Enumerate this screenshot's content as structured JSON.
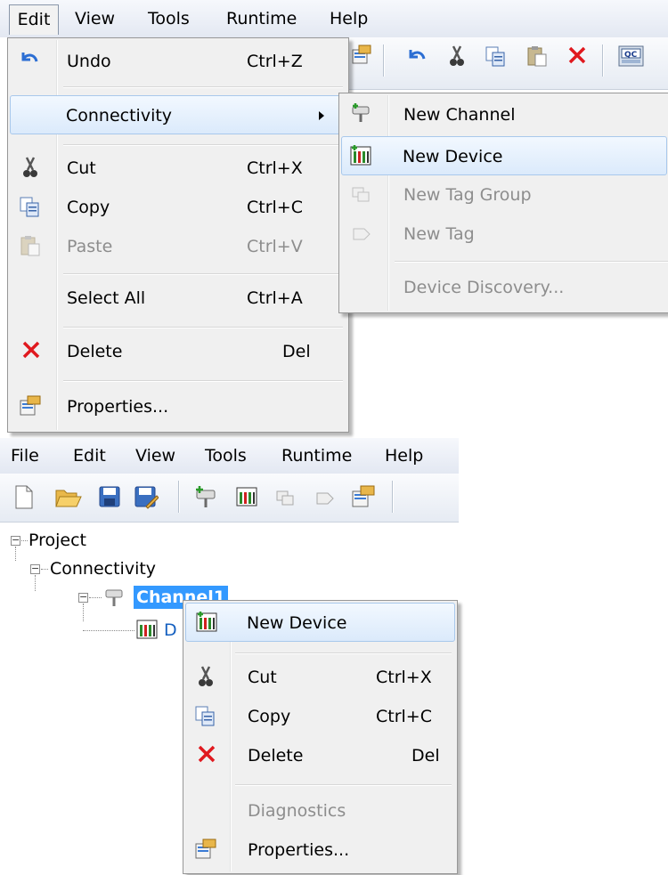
{
  "top": {
    "menubar": [
      "Edit",
      "View",
      "Tools",
      "Runtime",
      "Help"
    ],
    "edit_menu": {
      "undo": {
        "label": "Undo",
        "shortcut": "Ctrl+Z"
      },
      "connectivity": {
        "label": "Connectivity"
      },
      "cut": {
        "label": "Cut",
        "shortcut": "Ctrl+X"
      },
      "copy": {
        "label": "Copy",
        "shortcut": "Ctrl+C"
      },
      "paste": {
        "label": "Paste",
        "shortcut": "Ctrl+V"
      },
      "select_all": {
        "label": "Select All",
        "shortcut": "Ctrl+A"
      },
      "delete": {
        "label": "Delete",
        "shortcut": "Del"
      },
      "properties": {
        "label": "Properties..."
      }
    },
    "connectivity_submenu": {
      "new_channel": "New Channel",
      "new_device": "New Device",
      "new_tag_group": "New Tag Group",
      "new_tag": "New Tag",
      "device_discovery": "Device Discovery..."
    }
  },
  "bottom": {
    "menubar": [
      "File",
      "Edit",
      "View",
      "Tools",
      "Runtime",
      "Help"
    ],
    "tree": {
      "project": "Project",
      "connectivity": "Connectivity",
      "channel": "Channel1",
      "device_partial": "D"
    },
    "context_menu": {
      "new_device": "New Device",
      "cut": {
        "label": "Cut",
        "shortcut": "Ctrl+X"
      },
      "copy": {
        "label": "Copy",
        "shortcut": "Ctrl+C"
      },
      "delete": {
        "label": "Delete",
        "shortcut": "Del"
      },
      "diagnostics": "Diagnostics",
      "properties": "Properties..."
    }
  },
  "colors": {
    "selection": "#3399ff",
    "hover_border": "#a8c8ec",
    "menu_bg": "#f0f0f0",
    "disabled_text": "#8d8d8d",
    "delete_icon": "#e0191f"
  }
}
